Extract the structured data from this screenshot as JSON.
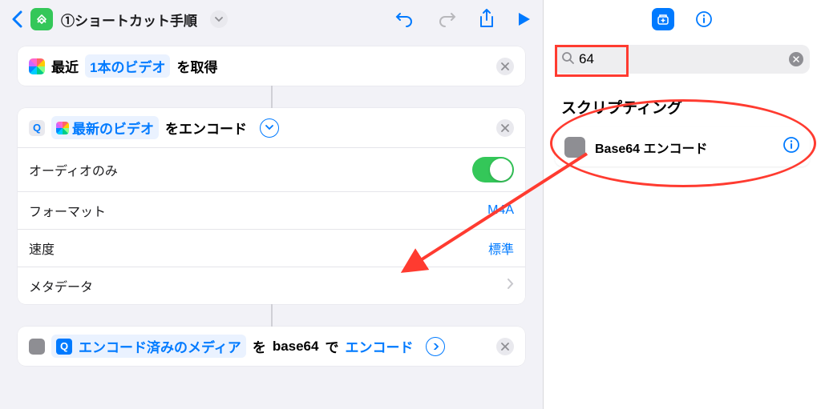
{
  "toolbar": {
    "title": "①ショートカット手順"
  },
  "actions": {
    "getVideo": {
      "prefix": "最近",
      "variable": "1本のビデオ",
      "suffix": "を取得"
    },
    "encode": {
      "variable": "最新のビデオ",
      "suffix": "をエンコード",
      "rows": {
        "audioOnly": "オーディオのみ",
        "format": {
          "label": "フォーマット",
          "value": "M4A"
        },
        "speed": {
          "label": "速度",
          "value": "標準"
        },
        "metadata": "メタデータ"
      }
    },
    "base64": {
      "variable": "エンコード済みのメディア",
      "mid1": "を",
      "mode": "base64",
      "mid2": "で",
      "action": "エンコード"
    }
  },
  "right": {
    "searchValue": "64",
    "sectionTitle": "スクリプティング",
    "result": "Base64 エンコード"
  }
}
